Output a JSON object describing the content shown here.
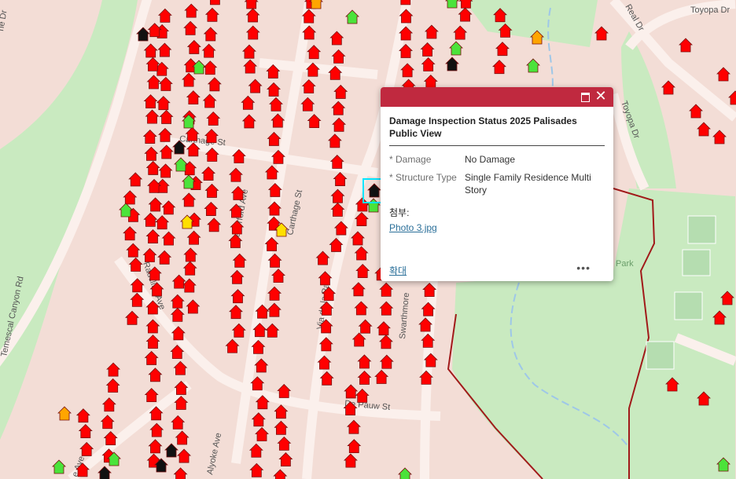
{
  "map": {
    "street_labels": [
      "Toyopa Dr",
      "Real Dr",
      "Carthage St",
      "Haverford Ave",
      "Carthage St",
      "Radcliffe Ave",
      "Temescal Canyon Rd",
      "Via de la Paz",
      "Swarthmore",
      "De Pauw St",
      "Alyoke Ave",
      "e Ave",
      "ne Dr",
      "Toyopa Dr",
      "Park"
    ],
    "colors": {
      "background": "#f3ddd6",
      "park": "#c9eac0",
      "road": "#fbf0ec",
      "road_edge": "#e8d1c9",
      "boundary": "#a11a1a",
      "destroyed": "#ff0000",
      "no_damage": "#4be33a",
      "affected": "#ffdf00",
      "minor": "#ffa500",
      "inaccessible": "#111111",
      "popup_header": "#c0293f"
    }
  },
  "popup": {
    "title": "Damage Inspection Status 2025 Palisades Public View",
    "fields": [
      {
        "label": "* Damage",
        "value": "No Damage"
      },
      {
        "label": "* Structure Type",
        "value": "Single Family Residence Multi Story"
      }
    ],
    "attachments_label": "첨부:",
    "attachment": "Photo 3.jpg",
    "zoom_label": "확대",
    "more_label": "•••"
  }
}
